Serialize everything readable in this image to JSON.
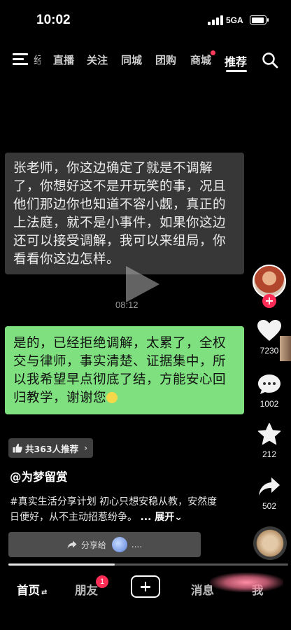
{
  "status_bar": {
    "time": "10:02",
    "network": "5GA"
  },
  "top_nav": {
    "partial_tab": "经",
    "tabs": [
      {
        "label": "直播"
      },
      {
        "label": "关注"
      },
      {
        "label": "同城"
      },
      {
        "label": "团购"
      },
      {
        "label": "商城",
        "has_dot": true
      },
      {
        "label": "推荐",
        "active": true
      }
    ]
  },
  "video": {
    "message_gray": "张老师，你这边确定了就是不调解了，你想好这不是开玩笑的事，况且他们那边你也知道不容小觑，真正的上法庭，就不是小事件，如果你这边还可以接受调解，我可以来组局，你看看你这边怎样。",
    "timestamp": "08:12",
    "message_green": "是的，已经拒绝调解，太累了，全权交与律师，事实清楚、证据集中，所以我希望早点彻底了结，方能安心回归教学，谢谢您",
    "green_bubble_color": "#7ee07e",
    "progress_fraction": 0.38
  },
  "actions": {
    "likes": "7230",
    "comments": "1002",
    "favorites": "212",
    "shares": "502",
    "accent_color": "#ff2d55"
  },
  "caption": {
    "recommend_chip": "共363人推荐",
    "author": "@为梦留赏",
    "description": "#真实生活分享计划 初心只想安稳从教，安然度日便好，从不主动招惹纷争。",
    "more_label": "展开",
    "share_label": "分享给",
    "share_suffix": "...."
  },
  "bottom_nav": {
    "home": "首页",
    "friends": "朋友",
    "friends_badge": "1",
    "messages": "消息",
    "me": "我"
  }
}
